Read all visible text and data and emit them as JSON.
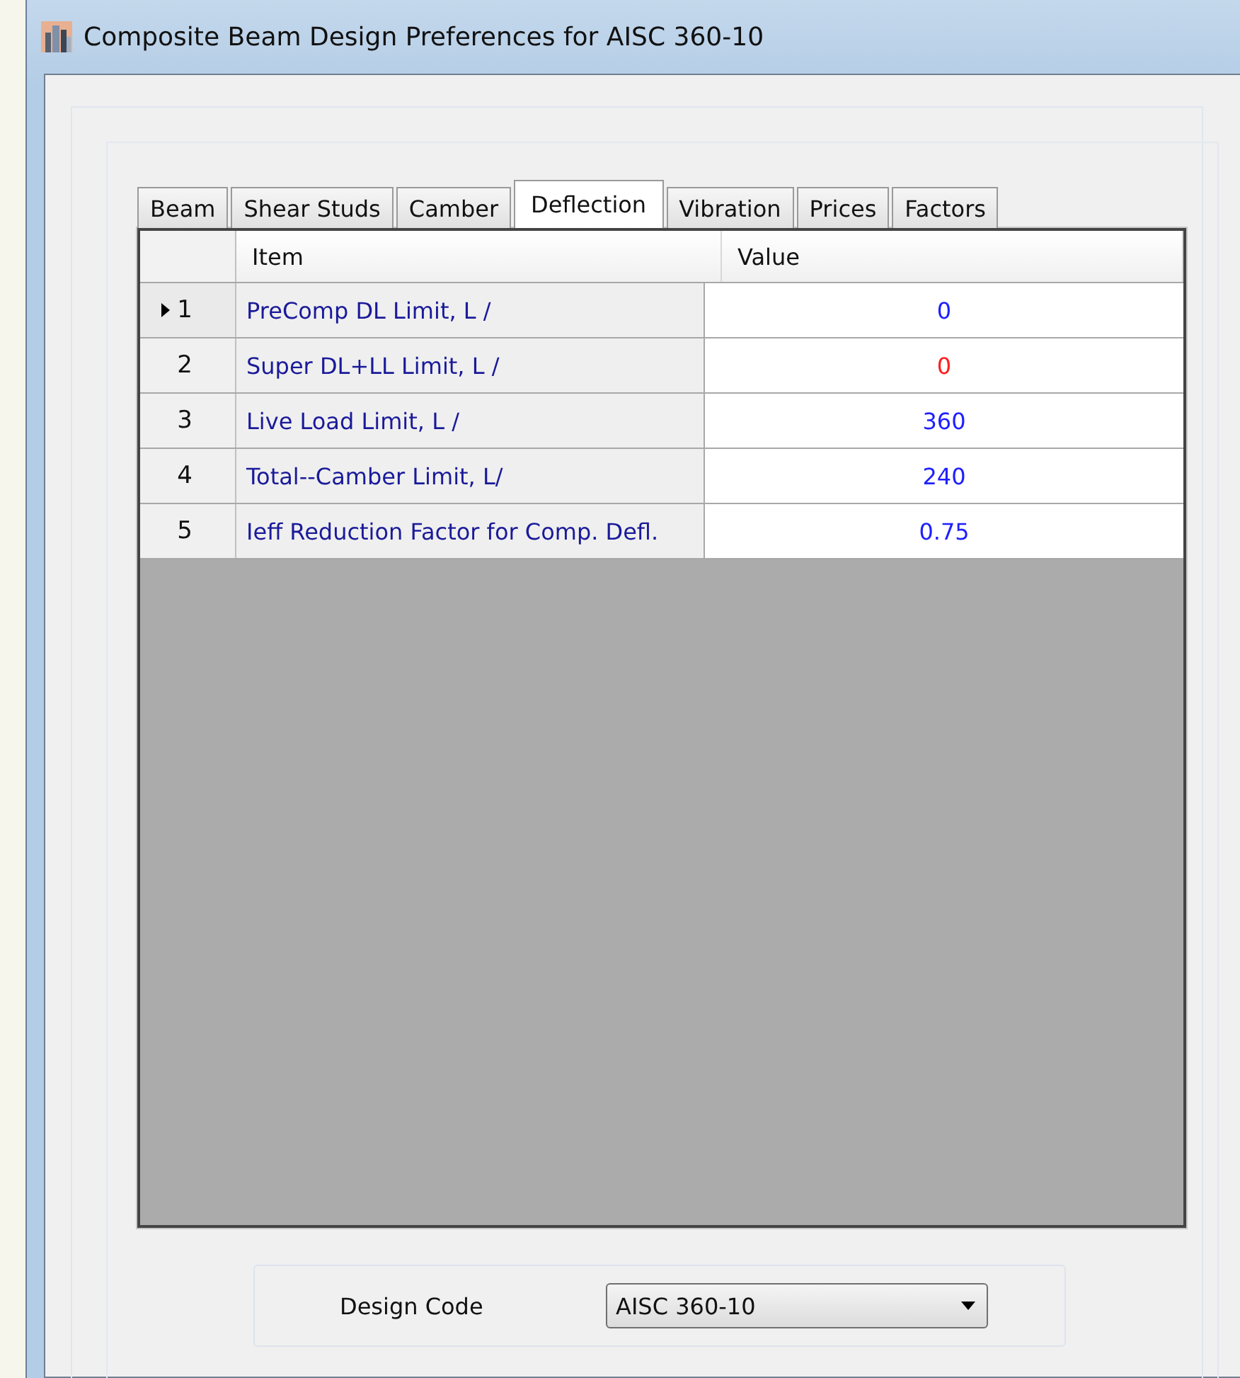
{
  "window": {
    "title": "Composite Beam Design Preferences for AISC 360-10"
  },
  "tabs": [
    {
      "label": "Beam",
      "selected": false
    },
    {
      "label": "Shear Studs",
      "selected": false
    },
    {
      "label": "Camber",
      "selected": false
    },
    {
      "label": "Deflection",
      "selected": true
    },
    {
      "label": "Vibration",
      "selected": false
    },
    {
      "label": "Prices",
      "selected": false
    },
    {
      "label": "Factors",
      "selected": false
    }
  ],
  "table": {
    "columns": [
      "Item",
      "Value"
    ],
    "rows": [
      {
        "number": "1",
        "item": "PreComp DL Limit, L /",
        "value": "0",
        "color": "#1f1fff",
        "selected": true
      },
      {
        "number": "2",
        "item": "Super DL+LL Limit, L /",
        "value": "0",
        "color": "#ff2020",
        "selected": false
      },
      {
        "number": "3",
        "item": "Live Load Limit, L /",
        "value": "360",
        "color": "#1f1fff",
        "selected": false
      },
      {
        "number": "4",
        "item": "Total--Camber Limit, L/",
        "value": "240",
        "color": "#1f1fff",
        "selected": false
      },
      {
        "number": "5",
        "item": "Ieff Reduction Factor for Comp. Defl.",
        "value": "0.75",
        "color": "#1f1fff",
        "selected": false
      }
    ]
  },
  "design_code": {
    "label": "Design Code",
    "value": "AISC 360-10"
  }
}
